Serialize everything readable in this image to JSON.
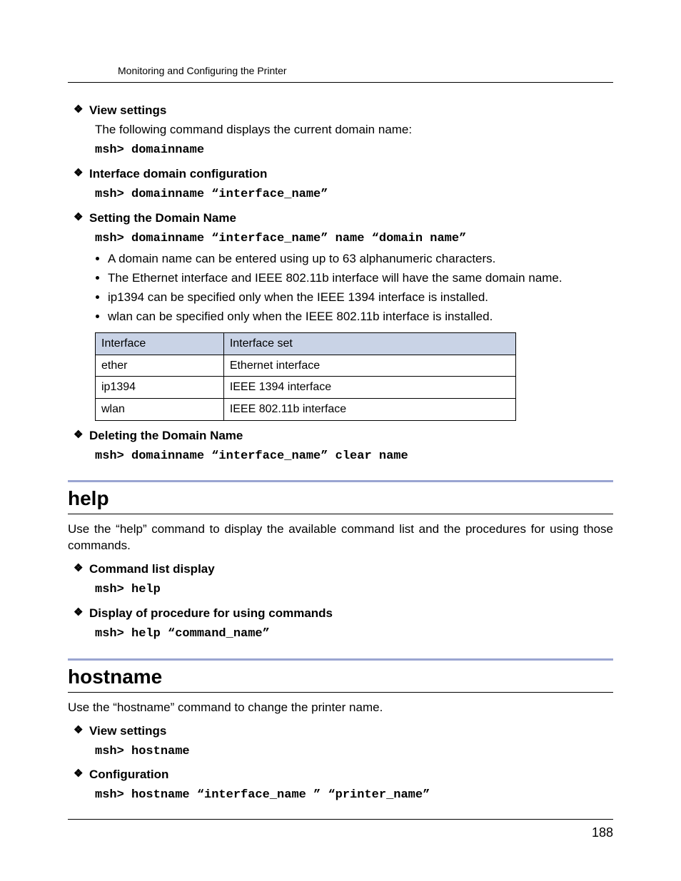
{
  "running_head": "Monitoring and Configuring the Printer",
  "page_number": "188",
  "domainname": {
    "view": {
      "title": "View settings",
      "desc": "The following command displays the current domain name:",
      "code": "msh> domainname"
    },
    "iface_cfg": {
      "title": "Interface domain configuration",
      "code": "msh> domainname “interface_name”"
    },
    "set": {
      "title": "Setting the Domain Name",
      "code": "msh> domainname “interface_name” name “domain name”",
      "bullets": {
        "b0": "A domain name can be entered using up to 63 alphanumeric characters.",
        "b1": "The Ethernet interface and IEEE 802.11b interface will have the same domain name.",
        "b2": "ip1394 can be specified only when the IEEE 1394 interface is installed.",
        "b3": "wlan can be specified only when the IEEE 802.11b interface is installed."
      },
      "table": {
        "h0": "Interface",
        "h1": "Interface set",
        "r0c0": "ether",
        "r0c1": "Ethernet interface",
        "r1c0": "ip1394",
        "r1c1": "IEEE 1394 interface",
        "r2c0": "wlan",
        "r2c1": "IEEE 802.11b interface"
      }
    },
    "delete": {
      "title": "Deleting the Domain Name",
      "code": "msh> domainname “interface_name” clear name"
    }
  },
  "help": {
    "heading": "help",
    "intro": "Use the “help” command to display the available command list and the procedures for using those commands.",
    "list": {
      "title": "Command list display",
      "code": "msh> help"
    },
    "proc": {
      "title": "Display of procedure for using commands",
      "code": "msh> help “command_name”"
    }
  },
  "hostname": {
    "heading": "hostname",
    "intro": "Use the “hostname” command to change the printer name.",
    "view": {
      "title": "View settings",
      "code": "msh> hostname"
    },
    "cfg": {
      "title": "Configuration",
      "code": "msh> hostname “interface_name ” “printer_name”"
    }
  }
}
